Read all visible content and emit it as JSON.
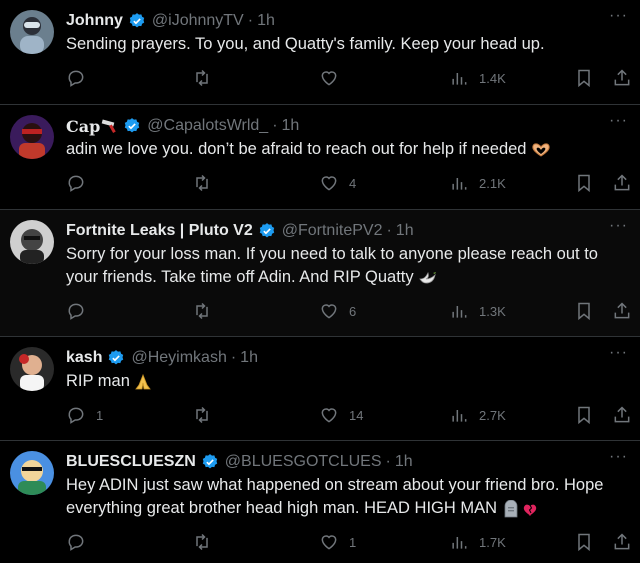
{
  "colors": {
    "verified": "#1d9bf0",
    "muted": "#71767b",
    "text": "#e7e9ea",
    "bg": "#000000"
  },
  "tweets": [
    {
      "name": "Johnny",
      "handle": "@iJohnnyTV",
      "time": "1h",
      "text": "Sending prayers. To you, and Quatty's family. Keep your head up.",
      "replies": "",
      "retweets": "",
      "likes": "",
      "views": "1.4K"
    },
    {
      "name": "Cap",
      "name_emoji": "razor-icon",
      "handle": "@CapalotsWrld_",
      "time": "1h",
      "text": "adin we love you. don’t be afraid to reach out for help if needed",
      "text_emoji": "heart-hands-emoji",
      "replies": "",
      "retweets": "",
      "likes": "4",
      "views": "2.1K"
    },
    {
      "name": "Fortnite Leaks | Pluto V2",
      "handle": "@FortnitePV2",
      "time": "1h",
      "text": "Sorry for your loss man. If you need to talk to anyone please reach out to your friends. Take time off Adin. And RIP Quatty",
      "text_emoji": "dove-emoji",
      "replies": "",
      "retweets": "",
      "likes": "6",
      "views": "1.3K"
    },
    {
      "name": "kash",
      "handle": "@Heyimkash",
      "time": "1h",
      "text": "RIP man",
      "text_emoji": "praying-hands-emoji",
      "replies": "1",
      "retweets": "",
      "likes": "14",
      "views": "2.7K"
    },
    {
      "name": "BLUESCLUESZN",
      "handle": "@BLUESGOTCLUES",
      "time": "1h",
      "text": "Hey ADIN just saw what happened on stream about your friend bro. Hope everything great brother head high man. HEAD HIGH MAN",
      "text_emoji": "headstone-broken-heart-emoji",
      "replies": "",
      "retweets": "",
      "likes": "1",
      "views": "1.7K"
    }
  ]
}
